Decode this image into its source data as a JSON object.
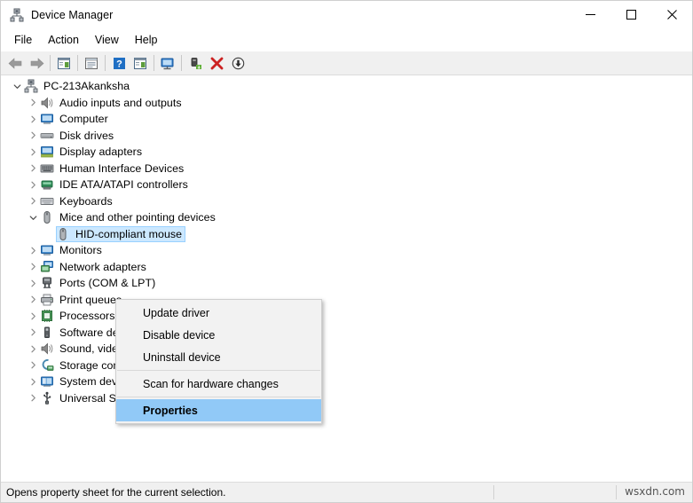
{
  "window": {
    "title": "Device Manager",
    "icon": "device-manager-icon",
    "controls": {
      "minimize": "–",
      "maximize": "☐",
      "close": "✕"
    }
  },
  "menubar": {
    "items": [
      {
        "label": "File",
        "name": "menu-file"
      },
      {
        "label": "Action",
        "name": "menu-action"
      },
      {
        "label": "View",
        "name": "menu-view"
      },
      {
        "label": "Help",
        "name": "menu-help"
      }
    ]
  },
  "toolbar": {
    "buttons": [
      {
        "name": "back-button",
        "icon": "back-arrow-icon"
      },
      {
        "name": "forward-button",
        "icon": "forward-arrow-icon"
      },
      {
        "name": "show-hide-console-tree-button",
        "icon": "console-tree-icon"
      },
      {
        "name": "properties-button",
        "icon": "properties-window-icon"
      },
      {
        "name": "help-button",
        "icon": "help-question-icon"
      },
      {
        "name": "view-list-button",
        "icon": "list-view-icon"
      },
      {
        "name": "scan-hardware-changes-button",
        "icon": "monitor-scan-icon"
      },
      {
        "name": "update-driver-button",
        "icon": "update-driver-icon"
      },
      {
        "name": "uninstall-device-button",
        "icon": "red-x-icon"
      },
      {
        "name": "disable-device-button",
        "icon": "down-arrow-circle-icon"
      }
    ]
  },
  "tree": {
    "root": {
      "label": "PC-213Akanksha",
      "icon": "computer-root-icon",
      "expanded": true
    },
    "nodes": [
      {
        "label": "Audio inputs and outputs",
        "icon": "speaker-icon",
        "expanded": false,
        "name": "tree-item-audio-inputs-and-outputs"
      },
      {
        "label": "Computer",
        "icon": "monitor-icon",
        "expanded": false,
        "name": "tree-item-computer"
      },
      {
        "label": "Disk drives",
        "icon": "disk-drive-icon",
        "expanded": false,
        "name": "tree-item-disk-drives"
      },
      {
        "label": "Display adapters",
        "icon": "display-adapter-icon",
        "expanded": false,
        "name": "tree-item-display-adapters"
      },
      {
        "label": "Human Interface Devices",
        "icon": "hid-icon",
        "expanded": false,
        "name": "tree-item-human-interface-devices"
      },
      {
        "label": "IDE ATA/ATAPI controllers",
        "icon": "ide-controller-icon",
        "expanded": false,
        "name": "tree-item-ide-ata-atapi-controllers"
      },
      {
        "label": "Keyboards",
        "icon": "keyboard-icon",
        "expanded": false,
        "name": "tree-item-keyboards"
      },
      {
        "label": "Mice and other pointing devices",
        "icon": "mouse-icon",
        "expanded": true,
        "name": "tree-item-mice-and-other-pointing-devices"
      },
      {
        "label": "HID-compliant mouse",
        "icon": "mouse-icon",
        "child": true,
        "selected": true,
        "name": "tree-item-hid-compliant-mouse"
      },
      {
        "label": "Monitors",
        "icon": "monitor-icon",
        "expanded": false,
        "name": "tree-item-monitors"
      },
      {
        "label": "Network adapters",
        "icon": "network-adapter-icon",
        "expanded": false,
        "name": "tree-item-network-adapters"
      },
      {
        "label": "Ports (COM & LPT)",
        "icon": "port-icon",
        "expanded": false,
        "name": "tree-item-ports"
      },
      {
        "label": "Print queues",
        "icon": "printer-icon",
        "expanded": false,
        "name": "tree-item-print-queues"
      },
      {
        "label": "Processors",
        "icon": "processor-icon",
        "expanded": false,
        "name": "tree-item-processors"
      },
      {
        "label": "Software devices",
        "icon": "software-device-icon",
        "expanded": false,
        "name": "tree-item-software-devices"
      },
      {
        "label": "Sound, video and game controllers",
        "icon": "speaker-icon",
        "expanded": false,
        "name": "tree-item-sound-video-and-game-controllers"
      },
      {
        "label": "Storage controllers",
        "icon": "storage-controller-icon",
        "expanded": false,
        "name": "tree-item-storage-controllers"
      },
      {
        "label": "System devices",
        "icon": "system-device-icon",
        "expanded": false,
        "name": "tree-item-system-devices"
      },
      {
        "label": "Universal Serial Bus controllers",
        "icon": "usb-icon",
        "expanded": false,
        "name": "tree-item-universal-serial-bus-controllers"
      }
    ]
  },
  "context_menu": {
    "items": [
      {
        "label": "Update driver",
        "name": "context-menu-update-driver",
        "type": "item"
      },
      {
        "label": "Disable device",
        "name": "context-menu-disable-device",
        "type": "item"
      },
      {
        "label": "Uninstall device",
        "name": "context-menu-uninstall-device",
        "type": "item"
      },
      {
        "type": "separator"
      },
      {
        "label": "Scan for hardware changes",
        "name": "context-menu-scan-for-hardware-changes",
        "type": "item"
      },
      {
        "type": "separator"
      },
      {
        "label": "Properties",
        "name": "context-menu-properties",
        "type": "item",
        "highlighted": true
      }
    ]
  },
  "statusbar": {
    "text": "Opens property sheet for the current selection.",
    "watermark": "wsxdn.com"
  },
  "colors": {
    "selection_fill": "#cce8ff",
    "selection_border": "#99d1ff",
    "menu_highlight": "#91c9f7",
    "toolbar_bg": "#f0f0f0",
    "statusbar_bg": "#f0f0f0"
  }
}
